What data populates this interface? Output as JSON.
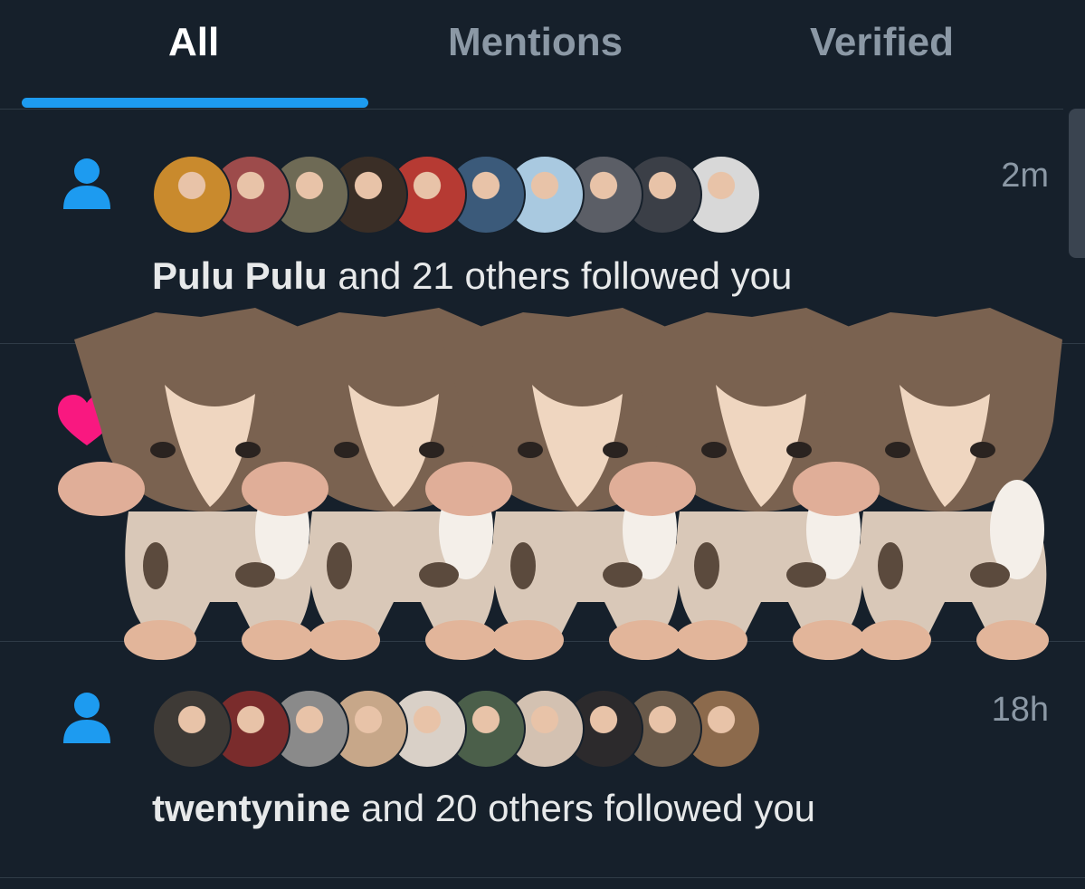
{
  "tabs": [
    {
      "label": "All",
      "active": true
    },
    {
      "label": "Mentions",
      "active": false
    },
    {
      "label": "Verified",
      "active": false
    }
  ],
  "notifications": [
    {
      "icon": "person-icon",
      "time": "2m",
      "name": "Pulu Pulu",
      "text": " and 21 others followed you",
      "avatar_colors": [
        "#c98a2d",
        "#9d4b4b",
        "#6e6a55",
        "#3a2e26",
        "#b63a33",
        "#3b5a7a",
        "#a9c9e0",
        "#5b5e66",
        "#3b3f47",
        "#d8d8d8"
      ]
    },
    {
      "icon": "heart-icon",
      "heart_color": "#f91880"
    },
    {
      "icon": "person-icon",
      "time": "18h",
      "name": "twentynine",
      "text": " and 20 others followed you",
      "avatar_colors": [
        "#3e3a36",
        "#7a2c2c",
        "#8a8a8a",
        "#c7a789",
        "#d9d0c7",
        "#4b5f4a",
        "#d3c1b1",
        "#2c2a2c",
        "#6a5a4a",
        "#8c6a4c"
      ]
    }
  ],
  "overlay": {
    "name": "dancing-cat-sticker",
    "count": 5
  },
  "colors": {
    "accent": "#1d9bf0",
    "background": "#16202b",
    "muted": "#8b98a5"
  }
}
